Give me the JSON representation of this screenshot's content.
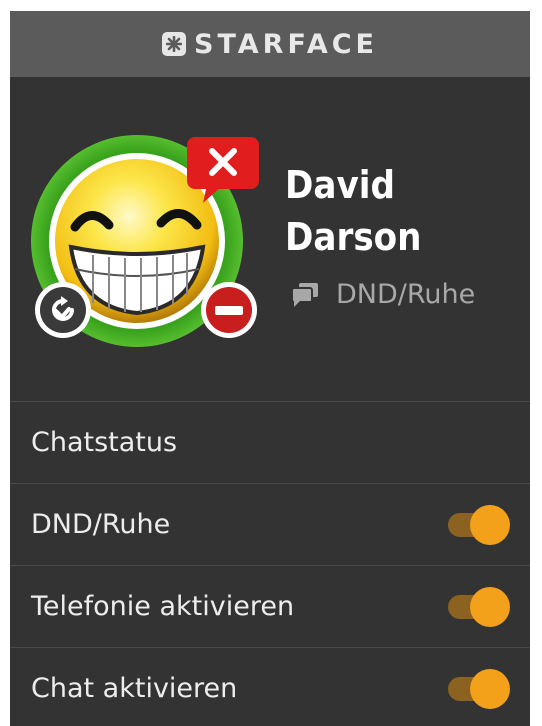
{
  "header": {
    "brand": "STARFACE"
  },
  "profile": {
    "first_name": "David",
    "last_name": "Darson",
    "status_text": "DND/Ruhe",
    "presence_color": "#47b325",
    "dnd_color": "#c81e1e"
  },
  "settings": {
    "items": [
      {
        "label": "Chatstatus",
        "has_toggle": false
      },
      {
        "label": "DND/Ruhe",
        "has_toggle": true,
        "on": true
      },
      {
        "label": "Telefonie aktivieren",
        "has_toggle": true,
        "on": true
      },
      {
        "label": "Chat aktivieren",
        "has_toggle": true,
        "on": true
      }
    ]
  },
  "colors": {
    "accent": "#f3a01b",
    "background": "#333333",
    "header": "#5b5b5b"
  }
}
